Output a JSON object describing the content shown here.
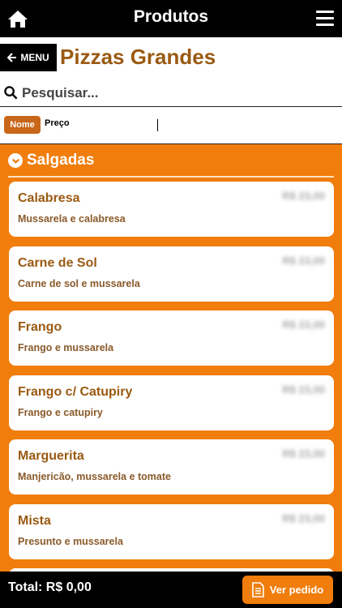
{
  "header": {
    "title": "Produtos",
    "home_icon": "home-icon",
    "menu_icon": "hamburger-icon"
  },
  "category": {
    "back_label": "MENU",
    "title": "Pizzas Grandes"
  },
  "search": {
    "placeholder": "Pesquisar..."
  },
  "sort": {
    "options": [
      "Nome",
      "Preço"
    ],
    "active": "Nome"
  },
  "section": {
    "title": "Salgadas"
  },
  "products": [
    {
      "name": "Calabresa",
      "description": "Mussarela e calabresa",
      "price": "R$ 23,00"
    },
    {
      "name": "Carne de Sol",
      "description": "Carne de sol e mussarela",
      "price": "R$ 23,00"
    },
    {
      "name": "Frango",
      "description": "Frango e mussarela",
      "price": "R$ 23,00"
    },
    {
      "name": "Frango c/ Catupiry",
      "description": "Frango e catupiry",
      "price": "R$ 23,00"
    },
    {
      "name": "Marguerita",
      "description": "Manjericão, mussarela e tomate",
      "price": "R$ 23,00"
    },
    {
      "name": "Mista",
      "description": "Presunto e mussarela",
      "price": "R$ 23,00"
    }
  ],
  "footer": {
    "total_label": "Total: R$ 0,00",
    "order_button": "Ver pedido"
  },
  "colors": {
    "accent": "#f07d0c",
    "title_brown": "#9a5a12",
    "bar": "#000000"
  }
}
